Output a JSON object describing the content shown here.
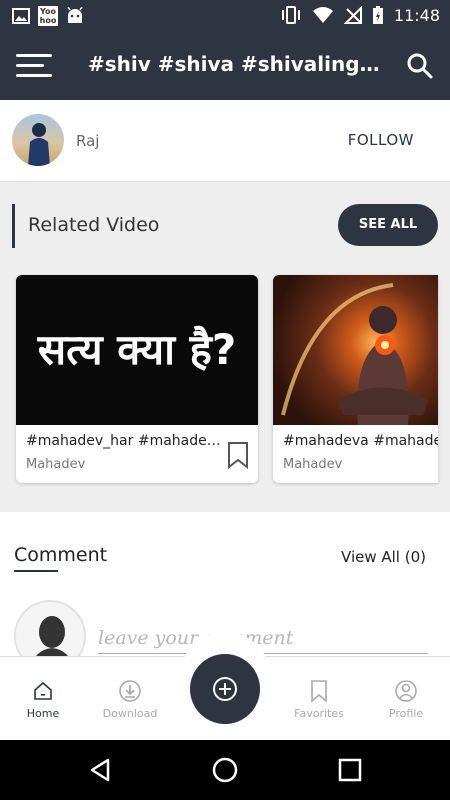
{
  "status_bar": {
    "time": "11:48",
    "notification_app": "Yoo hoo",
    "icons": [
      "image-icon",
      "yoohoo-icon",
      "android-icon",
      "vibrate-icon",
      "wifi-icon",
      "no-signal-icon",
      "battery-charging-icon"
    ]
  },
  "app_bar": {
    "title": "#shiv #shiva #shivalinga...",
    "menu_icon": "hamburger-menu-icon",
    "search_icon": "search-icon"
  },
  "author": {
    "name": "Raj",
    "follow_label": "FOLLOW"
  },
  "related": {
    "title": "Related Video",
    "see_all_label": "SEE ALL",
    "videos": [
      {
        "thumb_text": "सत्य क्या है?",
        "title": "#mahadev_har #mahadev_har...",
        "category": "Mahadev"
      },
      {
        "thumb_text": "",
        "title": "#mahadeva #mahadev",
        "category": "Mahadev"
      }
    ]
  },
  "comments": {
    "title": "Comment",
    "view_all_label": "View All (0)",
    "input_placeholder": "leave your comment"
  },
  "bottom_nav": {
    "items": [
      {
        "label": "Home",
        "icon": "home-icon",
        "active": true
      },
      {
        "label": "Download",
        "icon": "download-icon",
        "active": false
      },
      {
        "label": "Favorites",
        "icon": "bookmark-icon",
        "active": false
      },
      {
        "label": "Profile",
        "icon": "profile-icon",
        "active": false
      }
    ],
    "fab_icon": "add-circle-icon"
  },
  "system_nav": {
    "icons": [
      "back-icon",
      "home-circle-icon",
      "recents-icon"
    ]
  },
  "colors": {
    "primary": "#2f3441",
    "background": "#eeeeee",
    "surface": "#ffffff",
    "muted_text": "#aaaaaa"
  }
}
